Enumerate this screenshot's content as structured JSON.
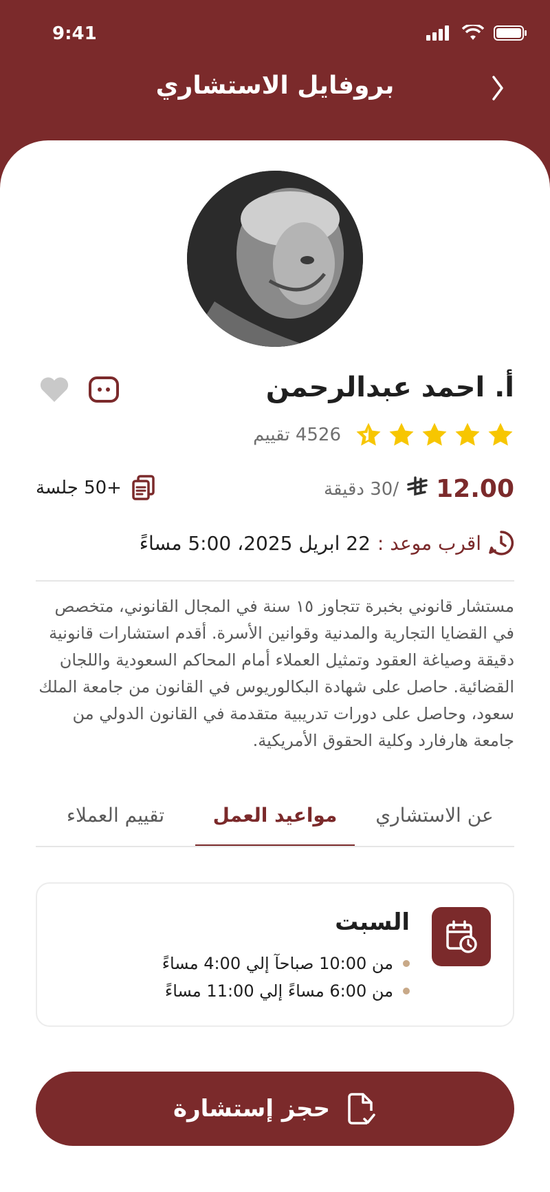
{
  "status_bar": {
    "time": "9:41"
  },
  "header": {
    "title": "بروفايل الاستشاري"
  },
  "consultant": {
    "name": "أ. احمد عبدالرحمن",
    "rating_count_text": "4526 تقييم",
    "stars": 4.5,
    "price": "12.00",
    "currency_symbol": "⃁",
    "per_duration": "/30 دقيقة",
    "sessions": "+50 جلسة",
    "next_label": "اقرب موعد :",
    "next_value": "22 ابريل 2025، 5:00 مساءً",
    "bio": "مستشار قانوني بخبرة تتجاوز ١٥ سنة في المجال القانوني، متخصص في القضايا التجارية والمدنية وقوانين الأسرة. أقدم استشارات قانونية دقيقة وصياغة العقود وتمثيل العملاء أمام المحاكم السعودية واللجان القضائية. حاصل على شهادة البكالوريوس في القانون من جامعة الملك سعود، وحاصل على دورات تدريبية متقدمة في القانون الدولي من جامعة هارفارد وكلية الحقوق الأمريكية."
  },
  "tabs": [
    {
      "label": "عن الاستشاري"
    },
    {
      "label": "مواعيد العمل",
      "active": true
    },
    {
      "label": "تقييم العملاء"
    }
  ],
  "schedule": {
    "day": "السبت",
    "slots": [
      "من 10:00 صباحآ  إلي 4:00 مساءً",
      "من 6:00 مساءً  إلي 11:00 مساءً"
    ]
  },
  "book_button": {
    "label": "حجز إستشارة"
  },
  "colors": {
    "primary": "#7b2a2b",
    "star": "#f7c600",
    "accent_dot": "#c8a988"
  }
}
